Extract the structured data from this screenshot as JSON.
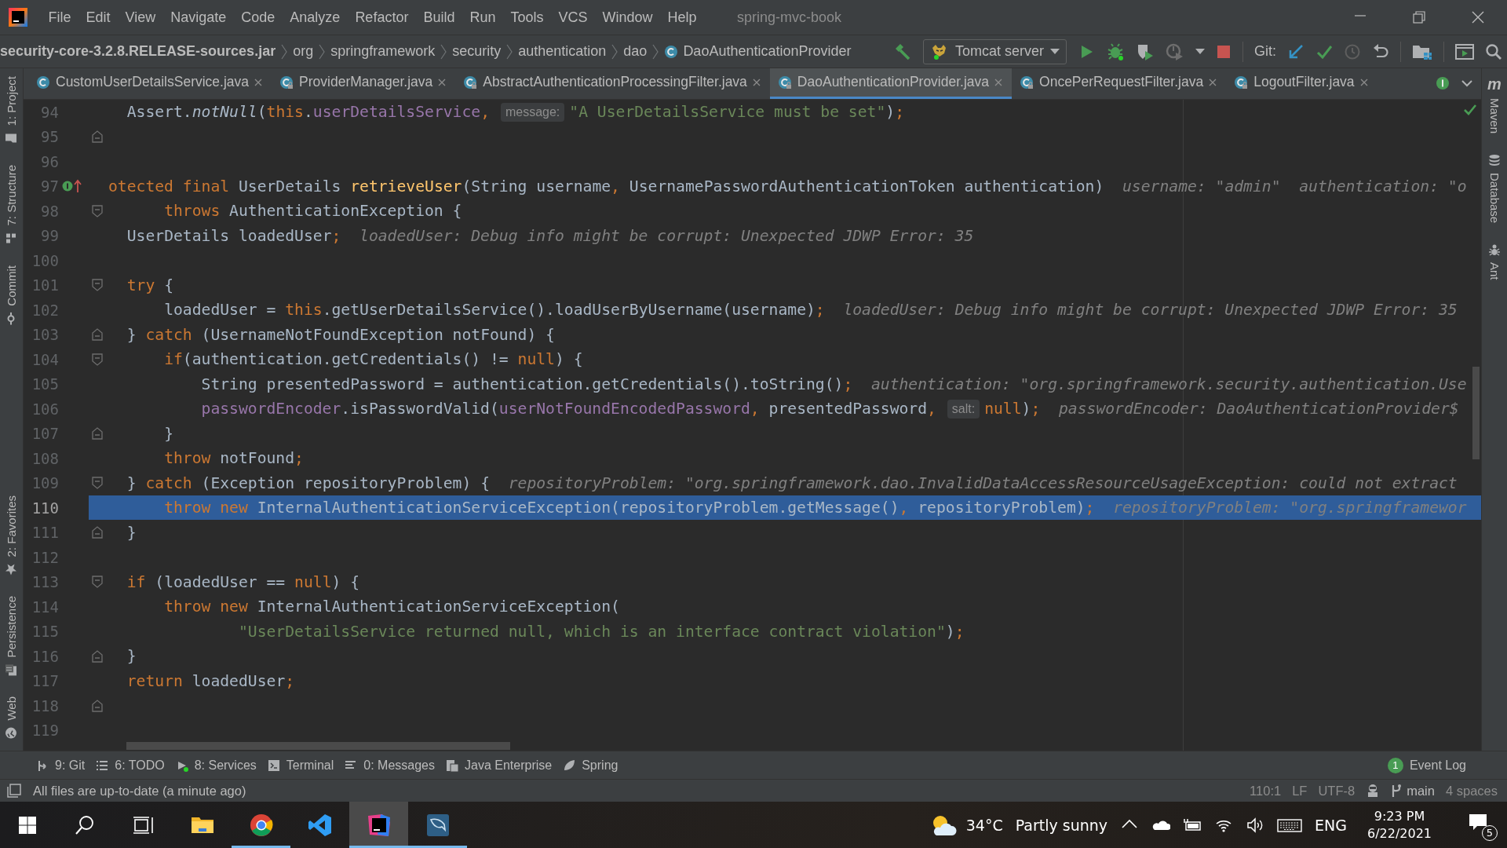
{
  "menu_bar": {
    "items": [
      "File",
      "Edit",
      "View",
      "Navigate",
      "Code",
      "Analyze",
      "Refactor",
      "Build",
      "Run",
      "Tools",
      "VCS",
      "Window",
      "Help"
    ],
    "project_title": "spring-mvc-book"
  },
  "navigation_bar": {
    "breadcrumbs": [
      {
        "label": "security-core-3.2.8.RELEASE-sources.jar",
        "kind": "jar"
      },
      {
        "label": "org",
        "kind": "package"
      },
      {
        "label": "springframework",
        "kind": "package"
      },
      {
        "label": "security",
        "kind": "package"
      },
      {
        "label": "authentication",
        "kind": "package"
      },
      {
        "label": "dao",
        "kind": "package"
      },
      {
        "label": "DaoAuthenticationProvider",
        "kind": "class"
      }
    ],
    "run_configuration": "Tomcat server",
    "vcs_label": "Git:"
  },
  "left_tool_strip": {
    "top": [
      {
        "label": "1: Project",
        "kind": "project"
      },
      {
        "label": "7: Structure",
        "kind": "structure"
      },
      {
        "label": "Commit",
        "kind": "commit"
      }
    ],
    "bottom": [
      {
        "label": "2: Favorites",
        "kind": "favorites"
      },
      {
        "label": "Persistence",
        "kind": "persistence"
      },
      {
        "label": "Web",
        "kind": "web"
      }
    ]
  },
  "editor_tabs": [
    {
      "label": "CustomUserDetailsService.java",
      "selected": false,
      "read_only": false
    },
    {
      "label": "ProviderManager.java",
      "selected": false,
      "read_only": true
    },
    {
      "label": "AbstractAuthenticationProcessingFilter.java",
      "selected": false,
      "read_only": true
    },
    {
      "label": "DaoAuthenticationProvider.java",
      "selected": true,
      "read_only": true
    },
    {
      "label": "OncePerRequestFilter.java",
      "selected": false,
      "read_only": true
    },
    {
      "label": "LogoutFilter.java",
      "selected": false,
      "read_only": true
    }
  ],
  "editor": {
    "lines": [
      {
        "number": "94",
        "selected": false,
        "tokens": [
          {
            "kind": "text",
            "text": "  Assert."
          },
          {
            "kind": "static",
            "text": "notNull"
          },
          {
            "kind": "text",
            "text": "("
          },
          {
            "kind": "kw",
            "text": "this"
          },
          {
            "kind": "text",
            "text": "."
          },
          {
            "kind": "field",
            "text": "userDetailsService"
          },
          {
            "kind": "kw",
            "text": ", "
          },
          {
            "kind": "hint",
            "text": "message:"
          },
          {
            "kind": "str",
            "text": "\"A UserDetailsService must be set\""
          },
          {
            "kind": "text",
            "text": ")"
          },
          {
            "kind": "kw",
            "text": ";"
          }
        ]
      },
      {
        "number": "95",
        "selected": false,
        "kind": "closing"
      },
      {
        "number": "96",
        "selected": false
      },
      {
        "number": "97",
        "selected": false,
        "kind": "override",
        "tokens": [
          {
            "kind": "kw",
            "text": "otected final "
          },
          {
            "kind": "text",
            "text": "UserDetails "
          },
          {
            "kind": "decl",
            "text": "retrieveUser"
          },
          {
            "kind": "text",
            "text": "(String username"
          },
          {
            "kind": "kw",
            "text": ", "
          },
          {
            "kind": "text",
            "text": "UsernamePasswordAuthenticationToken authentication)"
          },
          {
            "kind": "debug",
            "text": "username: \"admin\"  authentication: \"o"
          }
        ]
      },
      {
        "number": "98",
        "selected": false,
        "kind": "opening",
        "tokens": [
          {
            "kind": "kw",
            "text": "      throws "
          },
          {
            "kind": "text",
            "text": "AuthenticationException {"
          }
        ]
      },
      {
        "number": "99",
        "selected": false,
        "tokens": [
          {
            "kind": "text",
            "text": "  UserDetails loadedUser"
          },
          {
            "kind": "kw",
            "text": ";"
          },
          {
            "kind": "debug",
            "text": "loadedUser: Debug info might be corrupt: Unexpected JDWP Error: 35"
          }
        ]
      },
      {
        "number": "100",
        "selected": false
      },
      {
        "number": "101",
        "selected": false,
        "kind": "opening",
        "tokens": [
          {
            "kind": "kw",
            "text": "  try "
          },
          {
            "kind": "text",
            "text": "{"
          }
        ]
      },
      {
        "number": "102",
        "selected": false,
        "tokens": [
          {
            "kind": "text",
            "text": "      loadedUser = "
          },
          {
            "kind": "kw",
            "text": "this"
          },
          {
            "kind": "text",
            "text": ".getUserDetailsService().loadUserByUsername(username)"
          },
          {
            "kind": "kw",
            "text": ";"
          },
          {
            "kind": "debug",
            "text": "loadedUser: Debug info might be corrupt: Unexpected JDWP Error: 35"
          }
        ]
      },
      {
        "number": "103",
        "selected": false,
        "kind": "closing",
        "tokens": [
          {
            "kind": "text",
            "text": "  } "
          },
          {
            "kind": "kw",
            "text": "catch "
          },
          {
            "kind": "text",
            "text": "(UsernameNotFoundException notFound) {"
          }
        ]
      },
      {
        "number": "104",
        "selected": false,
        "kind": "opening",
        "tokens": [
          {
            "kind": "kw",
            "text": "      if"
          },
          {
            "kind": "text",
            "text": "(authentication.getCredentials() != "
          },
          {
            "kind": "kw",
            "text": "null"
          },
          {
            "kind": "text",
            "text": ") {"
          }
        ]
      },
      {
        "number": "105",
        "selected": false,
        "tokens": [
          {
            "kind": "text",
            "text": "          String presentedPassword = authentication.getCredentials().toString()"
          },
          {
            "kind": "kw",
            "text": ";"
          },
          {
            "kind": "debug",
            "text": "authentication: \"org.springframework.security.authentication.Use"
          }
        ]
      },
      {
        "number": "106",
        "selected": false,
        "tokens": [
          {
            "kind": "field",
            "text": "          passwordEncoder"
          },
          {
            "kind": "text",
            "text": ".isPasswordValid("
          },
          {
            "kind": "field",
            "text": "userNotFoundEncodedPassword"
          },
          {
            "kind": "kw",
            "text": ", "
          },
          {
            "kind": "text",
            "text": "presentedPassword"
          },
          {
            "kind": "kw",
            "text": ", "
          },
          {
            "kind": "hint",
            "text": "salt:"
          },
          {
            "kind": "kw",
            "text": "null"
          },
          {
            "kind": "text",
            "text": ")"
          },
          {
            "kind": "kw",
            "text": ";"
          },
          {
            "kind": "debug",
            "text": "passwordEncoder: DaoAuthenticationProvider$"
          }
        ]
      },
      {
        "number": "107",
        "selected": false,
        "kind": "closing",
        "tokens": [
          {
            "kind": "text",
            "text": "      }"
          }
        ]
      },
      {
        "number": "108",
        "selected": false,
        "tokens": [
          {
            "kind": "kw",
            "text": "      throw "
          },
          {
            "kind": "text",
            "text": "notFound"
          },
          {
            "kind": "kw",
            "text": ";"
          }
        ]
      },
      {
        "number": "109",
        "selected": false,
        "kind": "opening",
        "tokens": [
          {
            "kind": "text",
            "text": "  } "
          },
          {
            "kind": "kw",
            "text": "catch "
          },
          {
            "kind": "text",
            "text": "(Exception repositoryProblem) {"
          },
          {
            "kind": "debug",
            "text": "repositoryProblem: \"org.springframework.dao.InvalidDataAccessResourceUsageException: could not extract"
          }
        ]
      },
      {
        "number": "110",
        "selected": true,
        "tokens": [
          {
            "kind": "kw",
            "text": "      throw new "
          },
          {
            "kind": "text",
            "text": "InternalAuthenticationServiceException(repositoryProblem.getMessage()"
          },
          {
            "kind": "kw",
            "text": ", "
          },
          {
            "kind": "text",
            "text": "repositoryProblem)"
          },
          {
            "kind": "kw",
            "text": ";"
          },
          {
            "kind": "debug",
            "text": "repositoryProblem: \"org.springframewor"
          }
        ]
      },
      {
        "number": "111",
        "selected": false,
        "kind": "closing",
        "tokens": [
          {
            "kind": "text",
            "text": "  }"
          }
        ]
      },
      {
        "number": "112",
        "selected": false
      },
      {
        "number": "113",
        "selected": false,
        "kind": "opening",
        "tokens": [
          {
            "kind": "kw",
            "text": "  if "
          },
          {
            "kind": "text",
            "text": "(loadedUser == "
          },
          {
            "kind": "kw",
            "text": "null"
          },
          {
            "kind": "text",
            "text": ") {"
          }
        ]
      },
      {
        "number": "114",
        "selected": false,
        "tokens": [
          {
            "kind": "kw",
            "text": "      throw new "
          },
          {
            "kind": "text",
            "text": "InternalAuthenticationServiceException("
          }
        ]
      },
      {
        "number": "115",
        "selected": false,
        "tokens": [
          {
            "kind": "str",
            "text": "              \"UserDetailsService returned null, which is an interface contract violation\""
          },
          {
            "kind": "text",
            "text": ")"
          },
          {
            "kind": "kw",
            "text": ";"
          }
        ]
      },
      {
        "number": "116",
        "selected": false,
        "kind": "closing",
        "tokens": [
          {
            "kind": "text",
            "text": "  }"
          }
        ]
      },
      {
        "number": "117",
        "selected": false,
        "tokens": [
          {
            "kind": "kw",
            "text": "  return "
          },
          {
            "kind": "text",
            "text": "loadedUser"
          },
          {
            "kind": "kw",
            "text": ";"
          }
        ]
      },
      {
        "number": "118",
        "selected": false,
        "kind": "closing"
      },
      {
        "number": "119",
        "selected": false
      }
    ]
  },
  "right_tool_strip": [
    {
      "label": "Maven",
      "kind": "maven",
      "glyph": "m"
    },
    {
      "label": "Database",
      "kind": "database"
    },
    {
      "label": "Ant",
      "kind": "ant"
    }
  ],
  "tool_windows": [
    {
      "label": "9: Git",
      "kind": "git"
    },
    {
      "label": "6: TODO",
      "kind": "todo"
    },
    {
      "label": "8: Services",
      "kind": "services"
    },
    {
      "label": "Terminal",
      "kind": "terminal"
    },
    {
      "label": "0: Messages",
      "kind": "messages"
    },
    {
      "label": "Java Enterprise",
      "kind": "enterprise"
    },
    {
      "label": "Spring",
      "kind": "spring"
    }
  ],
  "event_log": {
    "label": "Event Log",
    "count": "1"
  },
  "status_bar": {
    "message": "All files are up-to-date (a minute ago)",
    "position": "110:1",
    "line_separator": "LF",
    "encoding": "UTF-8",
    "branch": "main",
    "indent": "4 spaces"
  },
  "taskbar": {
    "apps": [
      {
        "kind": "explorer",
        "running": false,
        "active": false
      },
      {
        "kind": "chrome",
        "running": true,
        "active": false
      },
      {
        "kind": "vscode",
        "running": false,
        "active": false
      },
      {
        "kind": "intellij",
        "running": true,
        "active": true
      },
      {
        "kind": "workbench",
        "running": true,
        "active": false
      }
    ],
    "weather": {
      "temperature": "34°C",
      "condition": "Partly sunny"
    },
    "language": "ENG",
    "time": "9:23 PM",
    "date": "6/22/2021",
    "notifications": "5"
  }
}
